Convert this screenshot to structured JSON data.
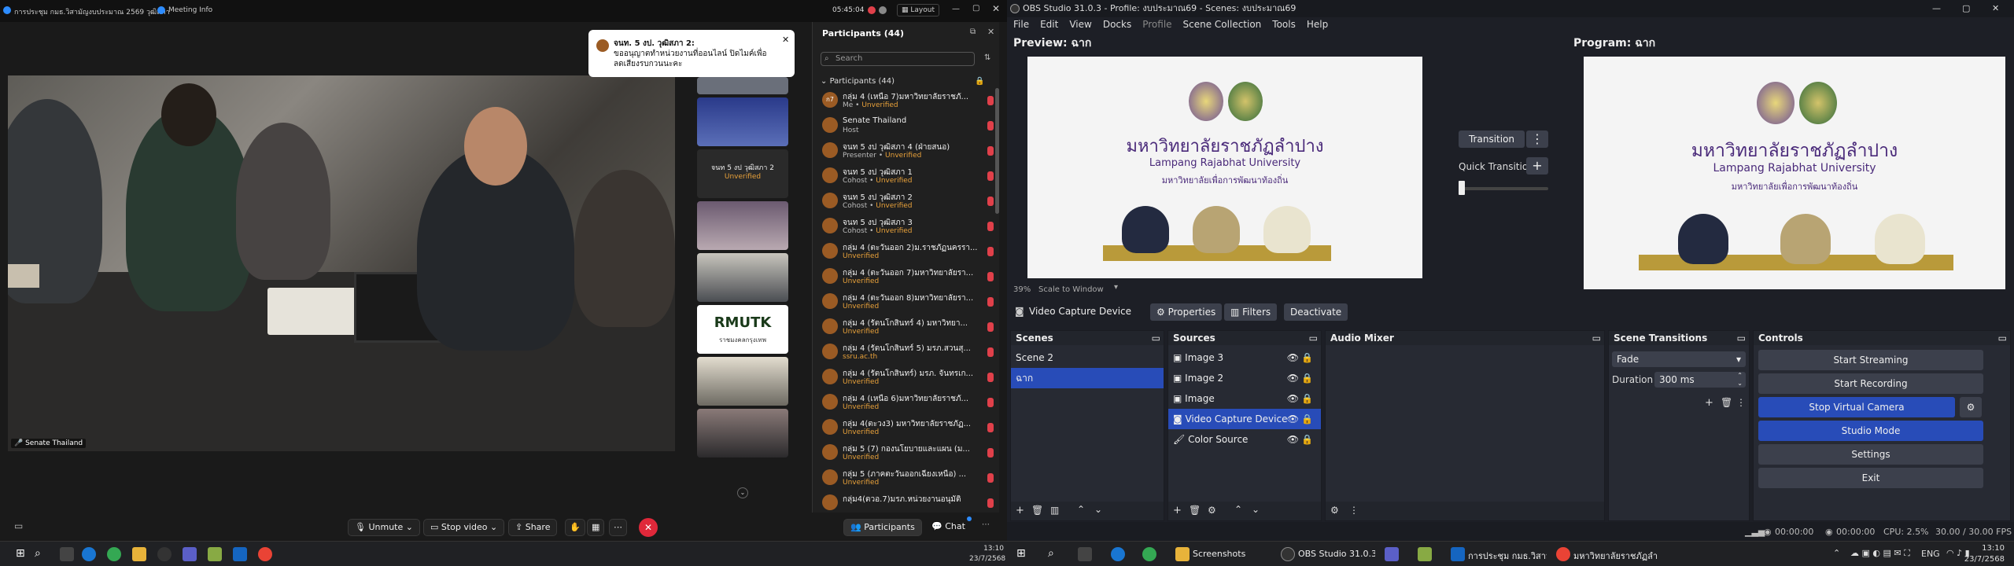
{
  "zoom": {
    "title": "การประชุม กมธ.วิสามัญงบประมาณ 2569 วุฒิสภา",
    "meeting_info": "Meeting Info",
    "clock": "05:45:04",
    "layout_label": "Layout",
    "main_speaker_label": "Senate Thailand",
    "notification": {
      "sender": "จนท. 5 งป. วุฒิสภา 2:",
      "message": "ขออนุญาตทำหน่วยงานที่ออนไลน์ ปิดไมค์เพื่อลดเสียงรบกวนนะคะ"
    },
    "thumb_label": "จนท 5 งป วุฒิสภา 2",
    "thumb_status": "Unverified",
    "thumb_logo_text": "RMUTK",
    "thumb_logo_sub": "ราชมงคลกรุงเทพ",
    "panel": {
      "title": "Participants (44)",
      "search_placeholder": "Search",
      "section_label": "Participants (44)"
    },
    "participants": [
      {
        "avatar": "ก7",
        "name": "กลุ่ม 4 (เหนือ 7)มหาวิทยาลัยราชภั...",
        "role": "Me",
        "status": "Unverified"
      },
      {
        "avatar": "",
        "name": "Senate Thailand",
        "role": "Host",
        "status": ""
      },
      {
        "avatar": "",
        "name": "จนท 5 งป วุฒิสภา 4 (ฝ่ายสนอ)",
        "role": "Presenter",
        "status": "Unverified"
      },
      {
        "avatar": "",
        "name": "จนท 5 งป วุฒิสภา 1",
        "role": "Cohost",
        "status": "Unverified"
      },
      {
        "avatar": "",
        "name": "จนท 5 งป วุฒิสภา 2",
        "role": "Cohost",
        "status": "Unverified"
      },
      {
        "avatar": "",
        "name": "จนท 5 งป วุฒิสภา 3",
        "role": "Cohost",
        "status": "Unverified"
      },
      {
        "avatar": "",
        "name": "กลุ่ม 4 (ตะวันออก 2)ม.ราชภัฏนครรา...",
        "role": "",
        "status": "Unverified"
      },
      {
        "avatar": "",
        "name": "กลุ่ม 4 (ตะวันออก 7)มหาวิทยาลัยรา...",
        "role": "",
        "status": "Unverified"
      },
      {
        "avatar": "",
        "name": "กลุ่ม 4 (ตะวันออก 8)มหาวิทยาลัยรา...",
        "role": "",
        "status": "Unverified"
      },
      {
        "avatar": "",
        "name": "กลุ่ม 4 (รัตนโกสินทร์ 4) มหาวิทยา...",
        "role": "",
        "status": "Unverified"
      },
      {
        "avatar": "",
        "name": "กลุ่ม 4 (รัตนโกสินทร์ 5) มรภ.สวนสุ...",
        "role": "",
        "status": "ssru.ac.th"
      },
      {
        "avatar": "",
        "name": "กลุ่ม 4 (รัตนโกสินทร์) มรภ. จันทรเก...",
        "role": "",
        "status": "Unverified"
      },
      {
        "avatar": "",
        "name": "กลุ่ม 4 (เหนือ 6)มหาวิทยาลัยราชภั...",
        "role": "",
        "status": "Unverified"
      },
      {
        "avatar": "",
        "name": "กลุ่ม 4(ตะวง3) มหาวิทยาลัยราชภัฏ...",
        "role": "",
        "status": "Unverified"
      },
      {
        "avatar": "",
        "name": "กลุ่ม 5 (7) กองนโยบายและแผน (ม...",
        "role": "",
        "status": "Unverified"
      },
      {
        "avatar": "",
        "name": "กลุ่ม 5 (ภาคตะวันออกเฉียงเหนือ) ...",
        "role": "",
        "status": "Unverified"
      },
      {
        "avatar": "",
        "name": "กลุ่ม4(ตวอ.7)มรภ.หน่วยงานอนุมัติ",
        "role": "",
        "status": ""
      }
    ],
    "controls": {
      "unmute": "Unmute",
      "stop_video": "Stop video",
      "share": "Share",
      "participants": "Participants",
      "chat": "Chat"
    }
  },
  "obs": {
    "title": "OBS Studio 31.0.3 - Profile: งบประมาณ69 - Scenes: งบประมาณ69",
    "menu": [
      "File",
      "Edit",
      "View",
      "Docks",
      "Profile",
      "Scene Collection",
      "Tools",
      "Help"
    ],
    "preview_label": "Preview: ฉาก",
    "program_label": "Program: ฉาก",
    "university_thai": "มหาวิทยาลัยราชภัฏลำปาง",
    "university_en": "Lampang Rajabhat University",
    "university_slogan": "มหาวิทยาลัยเพื่อการพัฒนาท้องถิ่น",
    "transition_btn": "Transition",
    "quick_transitions": "Quick Transitions",
    "zoom_level": "39%",
    "scale_mode": "Scale to Window",
    "source_name": "Video Capture Device",
    "properties_btn": "Properties",
    "filters_btn": "Filters",
    "deactivate_btn": "Deactivate",
    "scenes_title": "Scenes",
    "scenes": [
      "Scene 2",
      "ฉาก"
    ],
    "sources_title": "Sources",
    "sources": [
      "Image 3",
      "Image 2",
      "Image",
      "Video Capture Device",
      "Color Source"
    ],
    "audio_title": "Audio Mixer",
    "transitions_title": "Scene Transitions",
    "transition_type": "Fade",
    "duration_label": "Duration",
    "duration_value": "300 ms",
    "controls_title": "Controls",
    "controls": [
      "Start Streaming",
      "Start Recording",
      "Stop Virtual Camera",
      "Studio Mode",
      "Settings",
      "Exit"
    ],
    "status": {
      "stream_time": "00:00:00",
      "rec_time": "00:00:00",
      "cpu": "CPU: 2.5%",
      "fps": "30.00 / 30.00 FPS"
    }
  },
  "taskbar": {
    "left_time": "13:10",
    "left_date": "23/7/2568",
    "apps": [
      "Screenshots",
      "OBS Studio 31.0.3 -...",
      "การประชุม กมธ.วิสามั...",
      "มหาวิทยาลัยราชภัฏลำ..."
    ],
    "lang": "ENG",
    "time": "13:10",
    "date": "23/7/2568"
  }
}
